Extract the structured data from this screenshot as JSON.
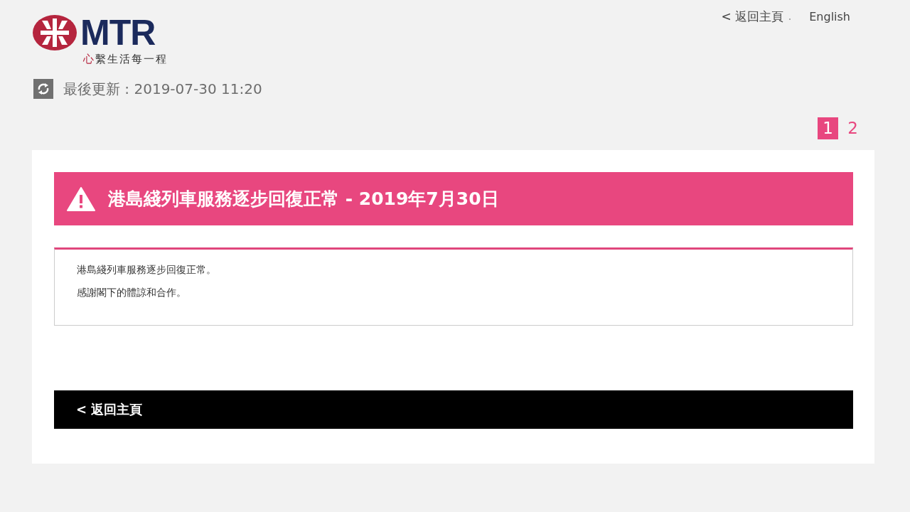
{
  "header": {
    "logo": {
      "wordmark": "MTR",
      "tagline_lead": "心",
      "tagline_rest": "繫生活每一程"
    },
    "nav": [
      {
        "kind": "back",
        "label": "< 返回主頁"
      },
      {
        "kind": "lang",
        "label": "English"
      }
    ]
  },
  "last_updated": "最後更新 : 2019-07-30 11:20",
  "pages": [
    {
      "label": "1",
      "selected": true
    },
    {
      "label": "2",
      "selected": false
    }
  ],
  "notice": {
    "title": "港島綫列車服務逐步回復正常 - 2019年7月30日",
    "paragraphs": [
      "港島綫列車服務逐步回復正常。",
      "感謝閣下的體諒和合作。"
    ]
  },
  "footer_link": "< 返回主頁"
}
